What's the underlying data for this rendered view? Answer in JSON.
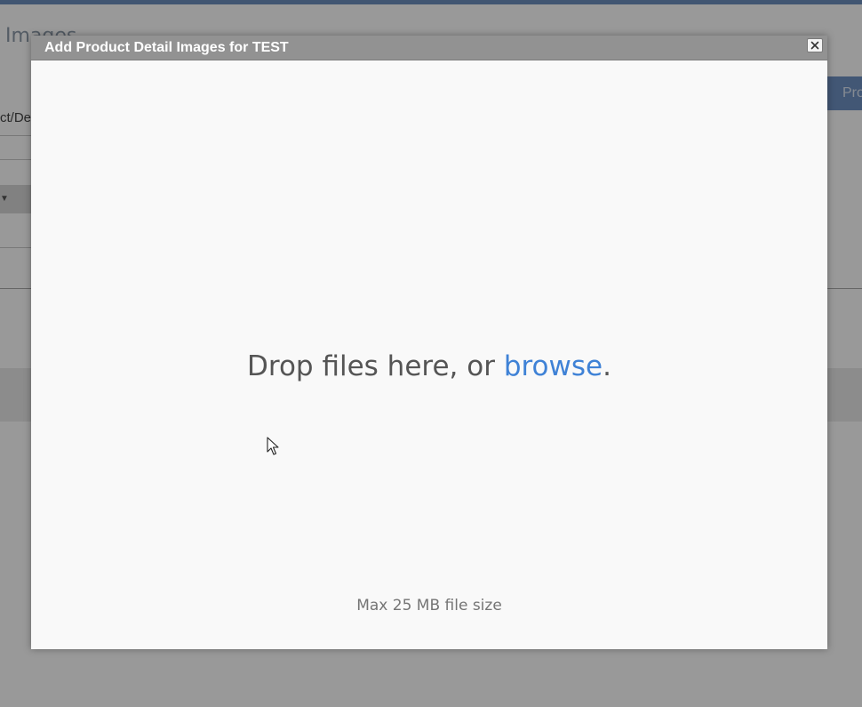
{
  "background": {
    "page_title": "Images",
    "button_label": "Pro",
    "column_label": "ct/De"
  },
  "modal": {
    "title": "Add Product Detail Images for TEST",
    "close_icon": "close-icon"
  },
  "dropzone": {
    "prompt_prefix": "Drop files here, or ",
    "browse_label": "browse",
    "prompt_suffix": ".",
    "max_size_note": "Max 25 MB file size"
  },
  "colors": {
    "accent": "#3f82d6",
    "header": "#929292",
    "top_bar": "#6d8fbf"
  }
}
